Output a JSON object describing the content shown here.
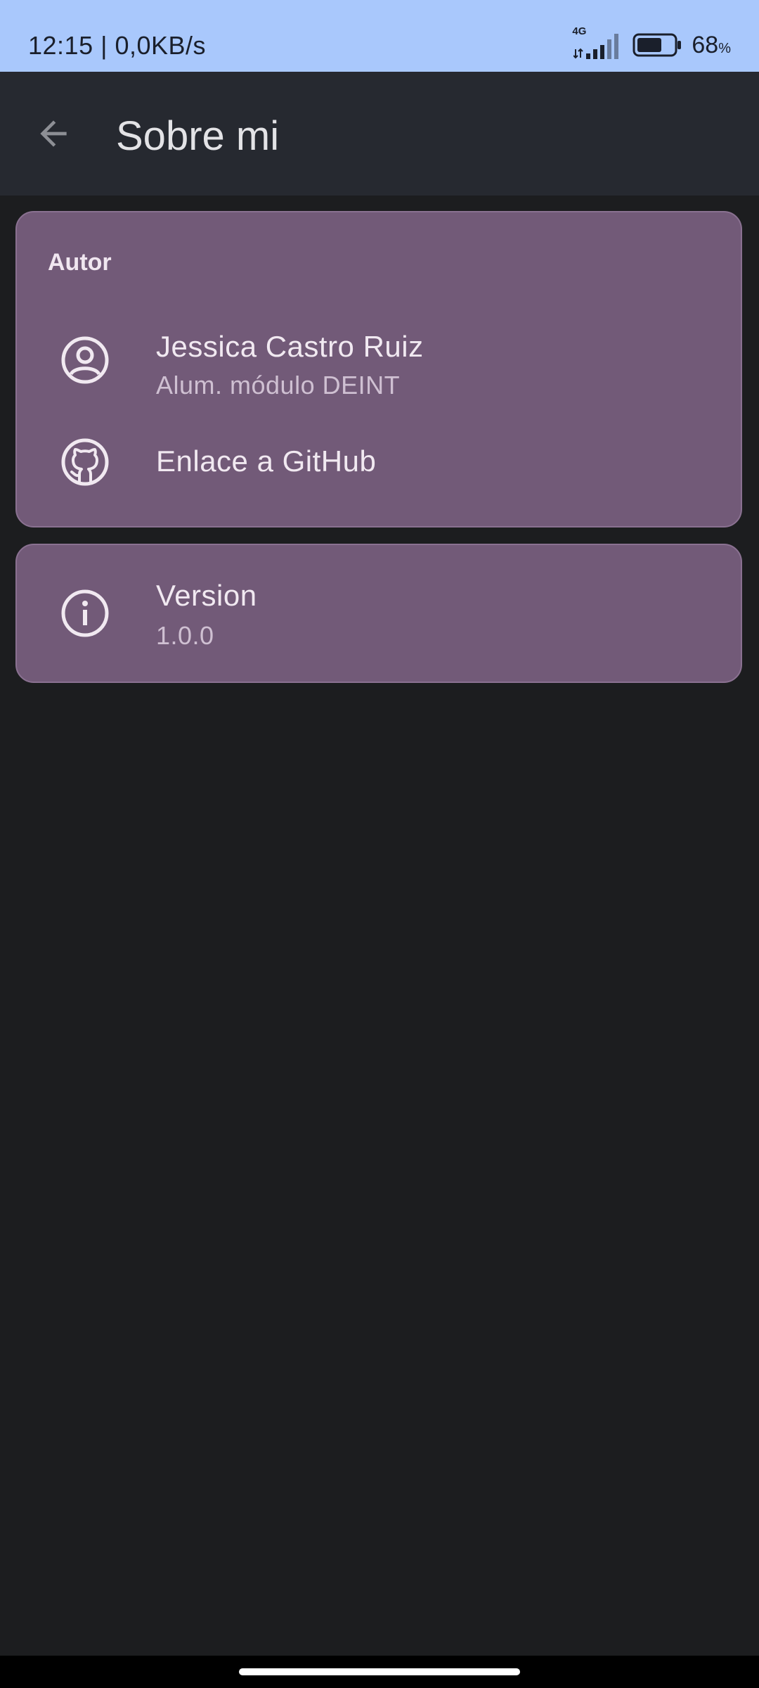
{
  "status_bar": {
    "time_speed": "12:15 | 0,0KB/s",
    "network": "4G",
    "battery_percent": "68",
    "battery_unit": "%",
    "battery_level": 0.68
  },
  "app_bar": {
    "back_icon": "arrow-back-icon",
    "title": "Sobre mi"
  },
  "author_card": {
    "section_title": "Autor",
    "author": {
      "icon": "account-circle-icon",
      "name": "Jessica Castro Ruiz",
      "subtitle": "Alum. módulo DEINT"
    },
    "github": {
      "icon": "github-icon",
      "label": "Enlace a GitHub"
    }
  },
  "version_card": {
    "icon": "info-icon",
    "title": "Version",
    "value": "1.0.0"
  },
  "colors": {
    "status_bar": "#a9c8fc",
    "app_bar": "#262930",
    "background": "#1c1d1f",
    "card": "#725a78"
  }
}
